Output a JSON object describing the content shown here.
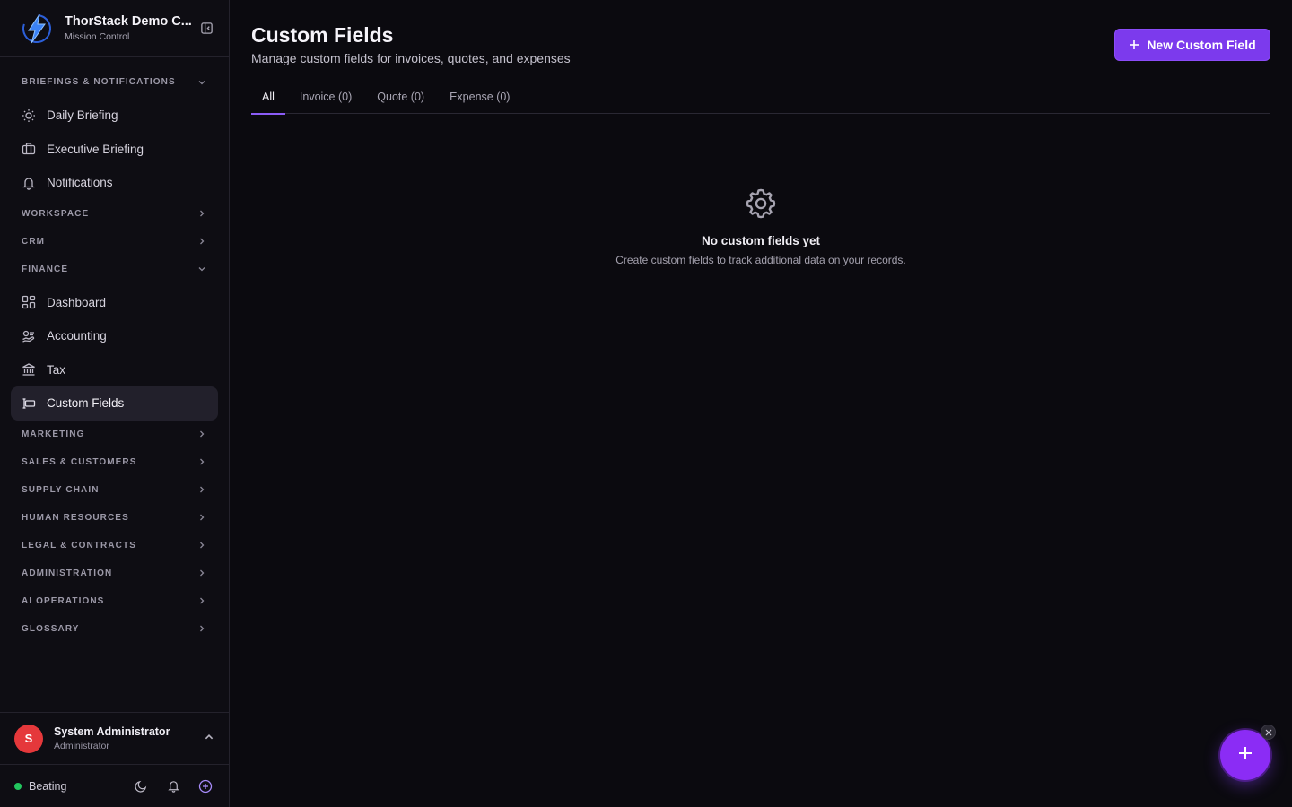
{
  "brand": {
    "title": "ThorStack Demo C...",
    "subtitle": "Mission Control"
  },
  "sidebar": {
    "sections": [
      {
        "label": "BRIEFINGS & NOTIFICATIONS",
        "expanded": true,
        "items": [
          {
            "label": "Daily Briefing",
            "icon": "sun-icon"
          },
          {
            "label": "Executive Briefing",
            "icon": "briefcase-icon"
          },
          {
            "label": "Notifications",
            "icon": "bell-icon"
          }
        ]
      },
      {
        "label": "WORKSPACE",
        "expanded": false
      },
      {
        "label": "CRM",
        "expanded": false
      },
      {
        "label": "FINANCE",
        "expanded": true,
        "items": [
          {
            "label": "Dashboard",
            "icon": "dashboard-icon"
          },
          {
            "label": "Accounting",
            "icon": "accounting-icon"
          },
          {
            "label": "Tax",
            "icon": "bank-icon"
          },
          {
            "label": "Custom Fields",
            "icon": "custom-fields-icon",
            "active": true
          }
        ]
      },
      {
        "label": "MARKETING",
        "expanded": false
      },
      {
        "label": "SALES & CUSTOMERS",
        "expanded": false
      },
      {
        "label": "SUPPLY CHAIN",
        "expanded": false
      },
      {
        "label": "HUMAN RESOURCES",
        "expanded": false
      },
      {
        "label": "LEGAL & CONTRACTS",
        "expanded": false
      },
      {
        "label": "ADMINISTRATION",
        "expanded": false
      },
      {
        "label": "AI OPERATIONS",
        "expanded": false
      },
      {
        "label": "GLOSSARY",
        "expanded": false
      }
    ]
  },
  "user": {
    "initial": "S",
    "name": "System Administrator",
    "role": "Administrator"
  },
  "footer": {
    "status": "Beating",
    "status_color": "#22c55e"
  },
  "page": {
    "title": "Custom Fields",
    "subtitle": "Manage custom fields for invoices, quotes, and expenses",
    "new_button": "New Custom Field"
  },
  "tabs": [
    {
      "label": "All",
      "active": true
    },
    {
      "label": "Invoice (0)"
    },
    {
      "label": "Quote (0)"
    },
    {
      "label": "Expense (0)"
    }
  ],
  "empty": {
    "title": "No custom fields yet",
    "description": "Create custom fields to track additional data on your records."
  },
  "colors": {
    "accent": "#7c3aed",
    "fab": "#8b2cf5",
    "avatar": "#e5383b"
  }
}
